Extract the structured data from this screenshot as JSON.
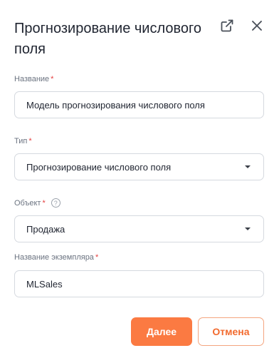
{
  "dialog": {
    "title": "Прогнозирование числового поля"
  },
  "icons": {
    "open_external": "open-external-icon",
    "close": "close-icon",
    "dropdown": "chevron-down-icon",
    "help": "question-icon"
  },
  "fields": {
    "name": {
      "label": "Название",
      "required_mark": "*",
      "value": "Модель прогнозирования числового поля"
    },
    "type": {
      "label": "Тип",
      "required_mark": "*",
      "value": "Прогнозирование числового поля"
    },
    "object": {
      "label": "Объект",
      "required_mark": "*",
      "help": "?",
      "value": "Продажа"
    },
    "instance_name": {
      "label": "Название экземпляра",
      "required_mark": "*",
      "value": "MLSales"
    }
  },
  "actions": {
    "next_label": "Далее",
    "cancel_label": "Отмена"
  },
  "colors": {
    "accent": "#fb7a42",
    "required": "#e53e3e",
    "border": "#d5d9df",
    "label": "#6b7380"
  }
}
